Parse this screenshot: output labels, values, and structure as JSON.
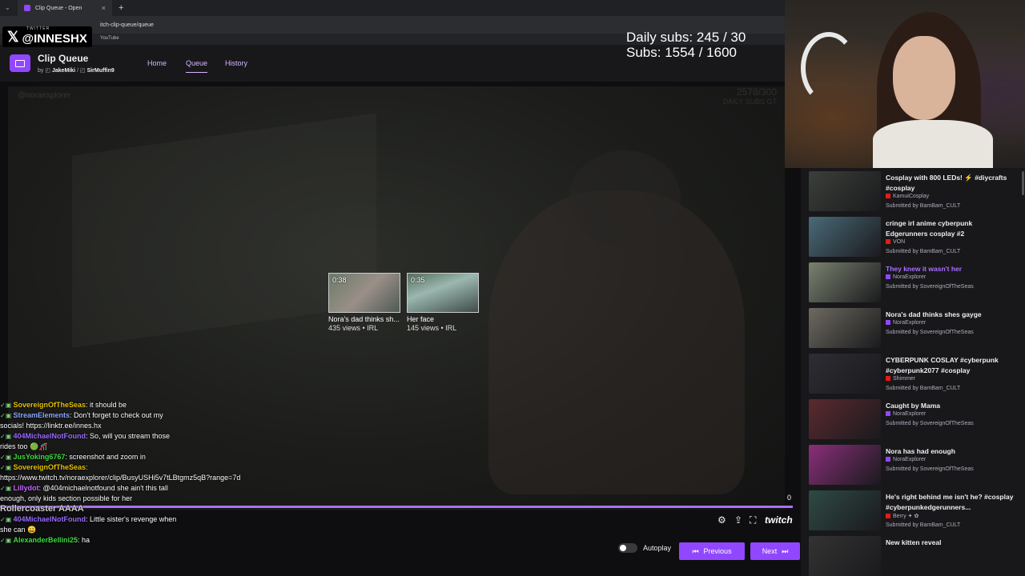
{
  "browser": {
    "tab_title": "Clip Queue - Open",
    "url": "itch-clip-queue/queue",
    "bookmark": "YouTube"
  },
  "twitter_overlay": {
    "small": "TWITTER",
    "handle": "@INNESHX"
  },
  "app": {
    "title": "Clip Queue",
    "by": "by",
    "author1": "JakeMiki",
    "author_sep": "/",
    "author2": "SirMuffin9",
    "nav": [
      "Home",
      "Queue",
      "History"
    ]
  },
  "subs": {
    "daily": "Daily subs: 245 / 30",
    "total": "Subs: 1554 / 1600"
  },
  "player": {
    "watermark": "@noraexplorer",
    "watermark2_top": "2578/300",
    "watermark2_bottom": "DAILY SUBS GT",
    "endcards": [
      {
        "duration": "0:38",
        "title": "Nora's dad thinks sh...",
        "meta": "435 views • IRL"
      },
      {
        "duration": "0:35",
        "title": "Her face",
        "meta": "145 views • IRL"
      }
    ],
    "counter": "0",
    "twitch": "twitch"
  },
  "controls": {
    "autoplay": "Autoplay",
    "previous": "Previous",
    "next": "Next"
  },
  "chat": [
    {
      "name": "SovereignOfTheSeas",
      "color": "#e6c300",
      "text": ": it should be"
    },
    {
      "name": "StreamElements",
      "color": "#8fa8ff",
      "text": ": Don't forget to check out my socials! https://linktr.ee/innes.hx"
    },
    {
      "name": "404MichaelNotFound",
      "color": "#9b6bff",
      "text": ": So, will you stream those rides too 🟢🎢"
    },
    {
      "name": "JusYoking6767",
      "color": "#3fdc3f",
      "text": ": screenshot and zoom in"
    },
    {
      "name": "SovereignOfTheSeas",
      "color": "#e6c300",
      "text": ":"
    },
    {
      "name": "",
      "color": "#fff",
      "text": "https://www.twitch.tv/noraexplorer/clip/BusyUSHi5v7tLBtgmz5qB?range=7d"
    },
    {
      "name": "Lillydot",
      "color": "#c266ff",
      "text": ": @404michaelnotfound she ain't this tall enough, only kids section possible for her"
    },
    {
      "name": "",
      "color": "#fff",
      "text": "Rollercoaster AAAA"
    },
    {
      "name": "404MichaelNotFound",
      "color": "#9b6bff",
      "text": ": Little sister's revenge when she can 😀"
    },
    {
      "name": "AlexanderBellini25",
      "color": "#3fdc3f",
      "text": ": ha"
    }
  ],
  "queue": [
    {
      "title": "Cosplay with 800 LEDs! ⚡ #diycrafts #cosplay",
      "channel": "KamuiCosplay",
      "submitted": "Submitted by BamBam_CULT",
      "chan_color": "#e91916",
      "thumb": "#3b3f3a",
      "active": false
    },
    {
      "title": "cringe irl anime cyberpunk Edgerunners cosplay #2",
      "channel": "VON",
      "submitted": "Submitted by BamBam_CULT",
      "chan_color": "#e91916",
      "thumb": "#4a6a78",
      "active": false
    },
    {
      "title": "They knew it wasn't her",
      "channel": "NoraExplorer",
      "submitted": "Submitted by SovereignOfTheSeas",
      "chan_color": "#9147ff",
      "thumb": "#7a8270",
      "active": true
    },
    {
      "title": "Nora's dad thinks shes gayge",
      "channel": "NoraExplorer",
      "submitted": "Submitted by SovereignOfTheSeas",
      "chan_color": "#9147ff",
      "thumb": "#6d6a60",
      "active": false
    },
    {
      "title": "CYBERPUNK COSLAY #cyberpunk #cyberpunk2077 #cosplay",
      "channel": "Shimmer",
      "submitted": "Submitted by BamBam_CULT",
      "chan_color": "#e91916",
      "thumb": "#2d2d33",
      "active": false
    },
    {
      "title": "Caught by Mama",
      "channel": "NoraExplorer",
      "submitted": "Submitted by SovereignOfTheSeas",
      "chan_color": "#9147ff",
      "thumb": "#5a2a2f",
      "active": false
    },
    {
      "title": "Nora has had enough",
      "channel": "NoraExplorer",
      "submitted": "Submitted by SovereignOfTheSeas",
      "chan_color": "#9147ff",
      "thumb": "#8a2f7a",
      "active": false
    },
    {
      "title": "He's right behind me isn't he? #cosplay #cyberpunkedgerunners...",
      "channel": "Berry ✦ ✿",
      "submitted": "Submitted by BamBam_CULT",
      "chan_color": "#e91916",
      "thumb": "#2f4a44",
      "active": false
    },
    {
      "title": "New kitten reveal",
      "channel": "",
      "submitted": "",
      "chan_color": "#9147ff",
      "thumb": "#333",
      "active": false
    }
  ]
}
